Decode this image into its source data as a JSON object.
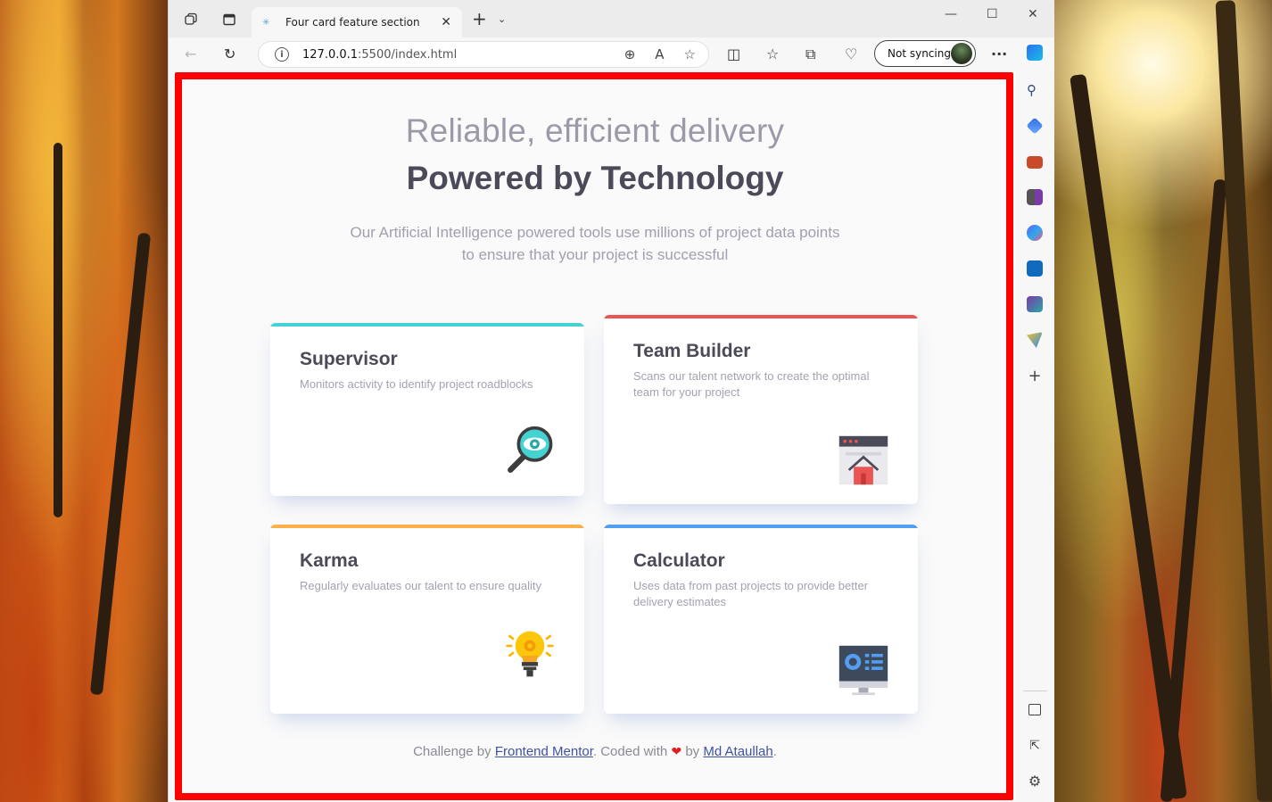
{
  "browser": {
    "tab_title": "Four card feature section",
    "url_host": "127.0.0.1",
    "url_path": ":5500/index.html",
    "sync_label": "Not syncing"
  },
  "page": {
    "heading_light": "Reliable, efficient delivery",
    "heading_bold": "Powered by Technology",
    "subtitle": "Our Artificial Intelligence powered tools use millions of project data points to ensure that your project is successful",
    "cards": [
      {
        "title": "Supervisor",
        "text": "Monitors activity to identify project roadblocks",
        "accent": "#44d3d2",
        "icon": "magnifier-eye-icon"
      },
      {
        "title": "Team Builder",
        "text": "Scans our talent network to create the optimal team for your project",
        "accent": "#ea5454",
        "icon": "browser-house-icon"
      },
      {
        "title": "Karma",
        "text": "Regularly evaluates our talent to ensure quality",
        "accent": "#fcaf4a",
        "icon": "lightbulb-gear-icon"
      },
      {
        "title": "Calculator",
        "text": "Uses data from past projects to provide better delivery estimates",
        "accent": "#549ef2",
        "icon": "monitor-chart-icon"
      }
    ],
    "footer": {
      "prefix": "Challenge by",
      "link1": "Frontend Mentor",
      "middle": ". Coded with",
      "by": "by",
      "link2": "Md Ataullah",
      "suffix": "."
    }
  }
}
